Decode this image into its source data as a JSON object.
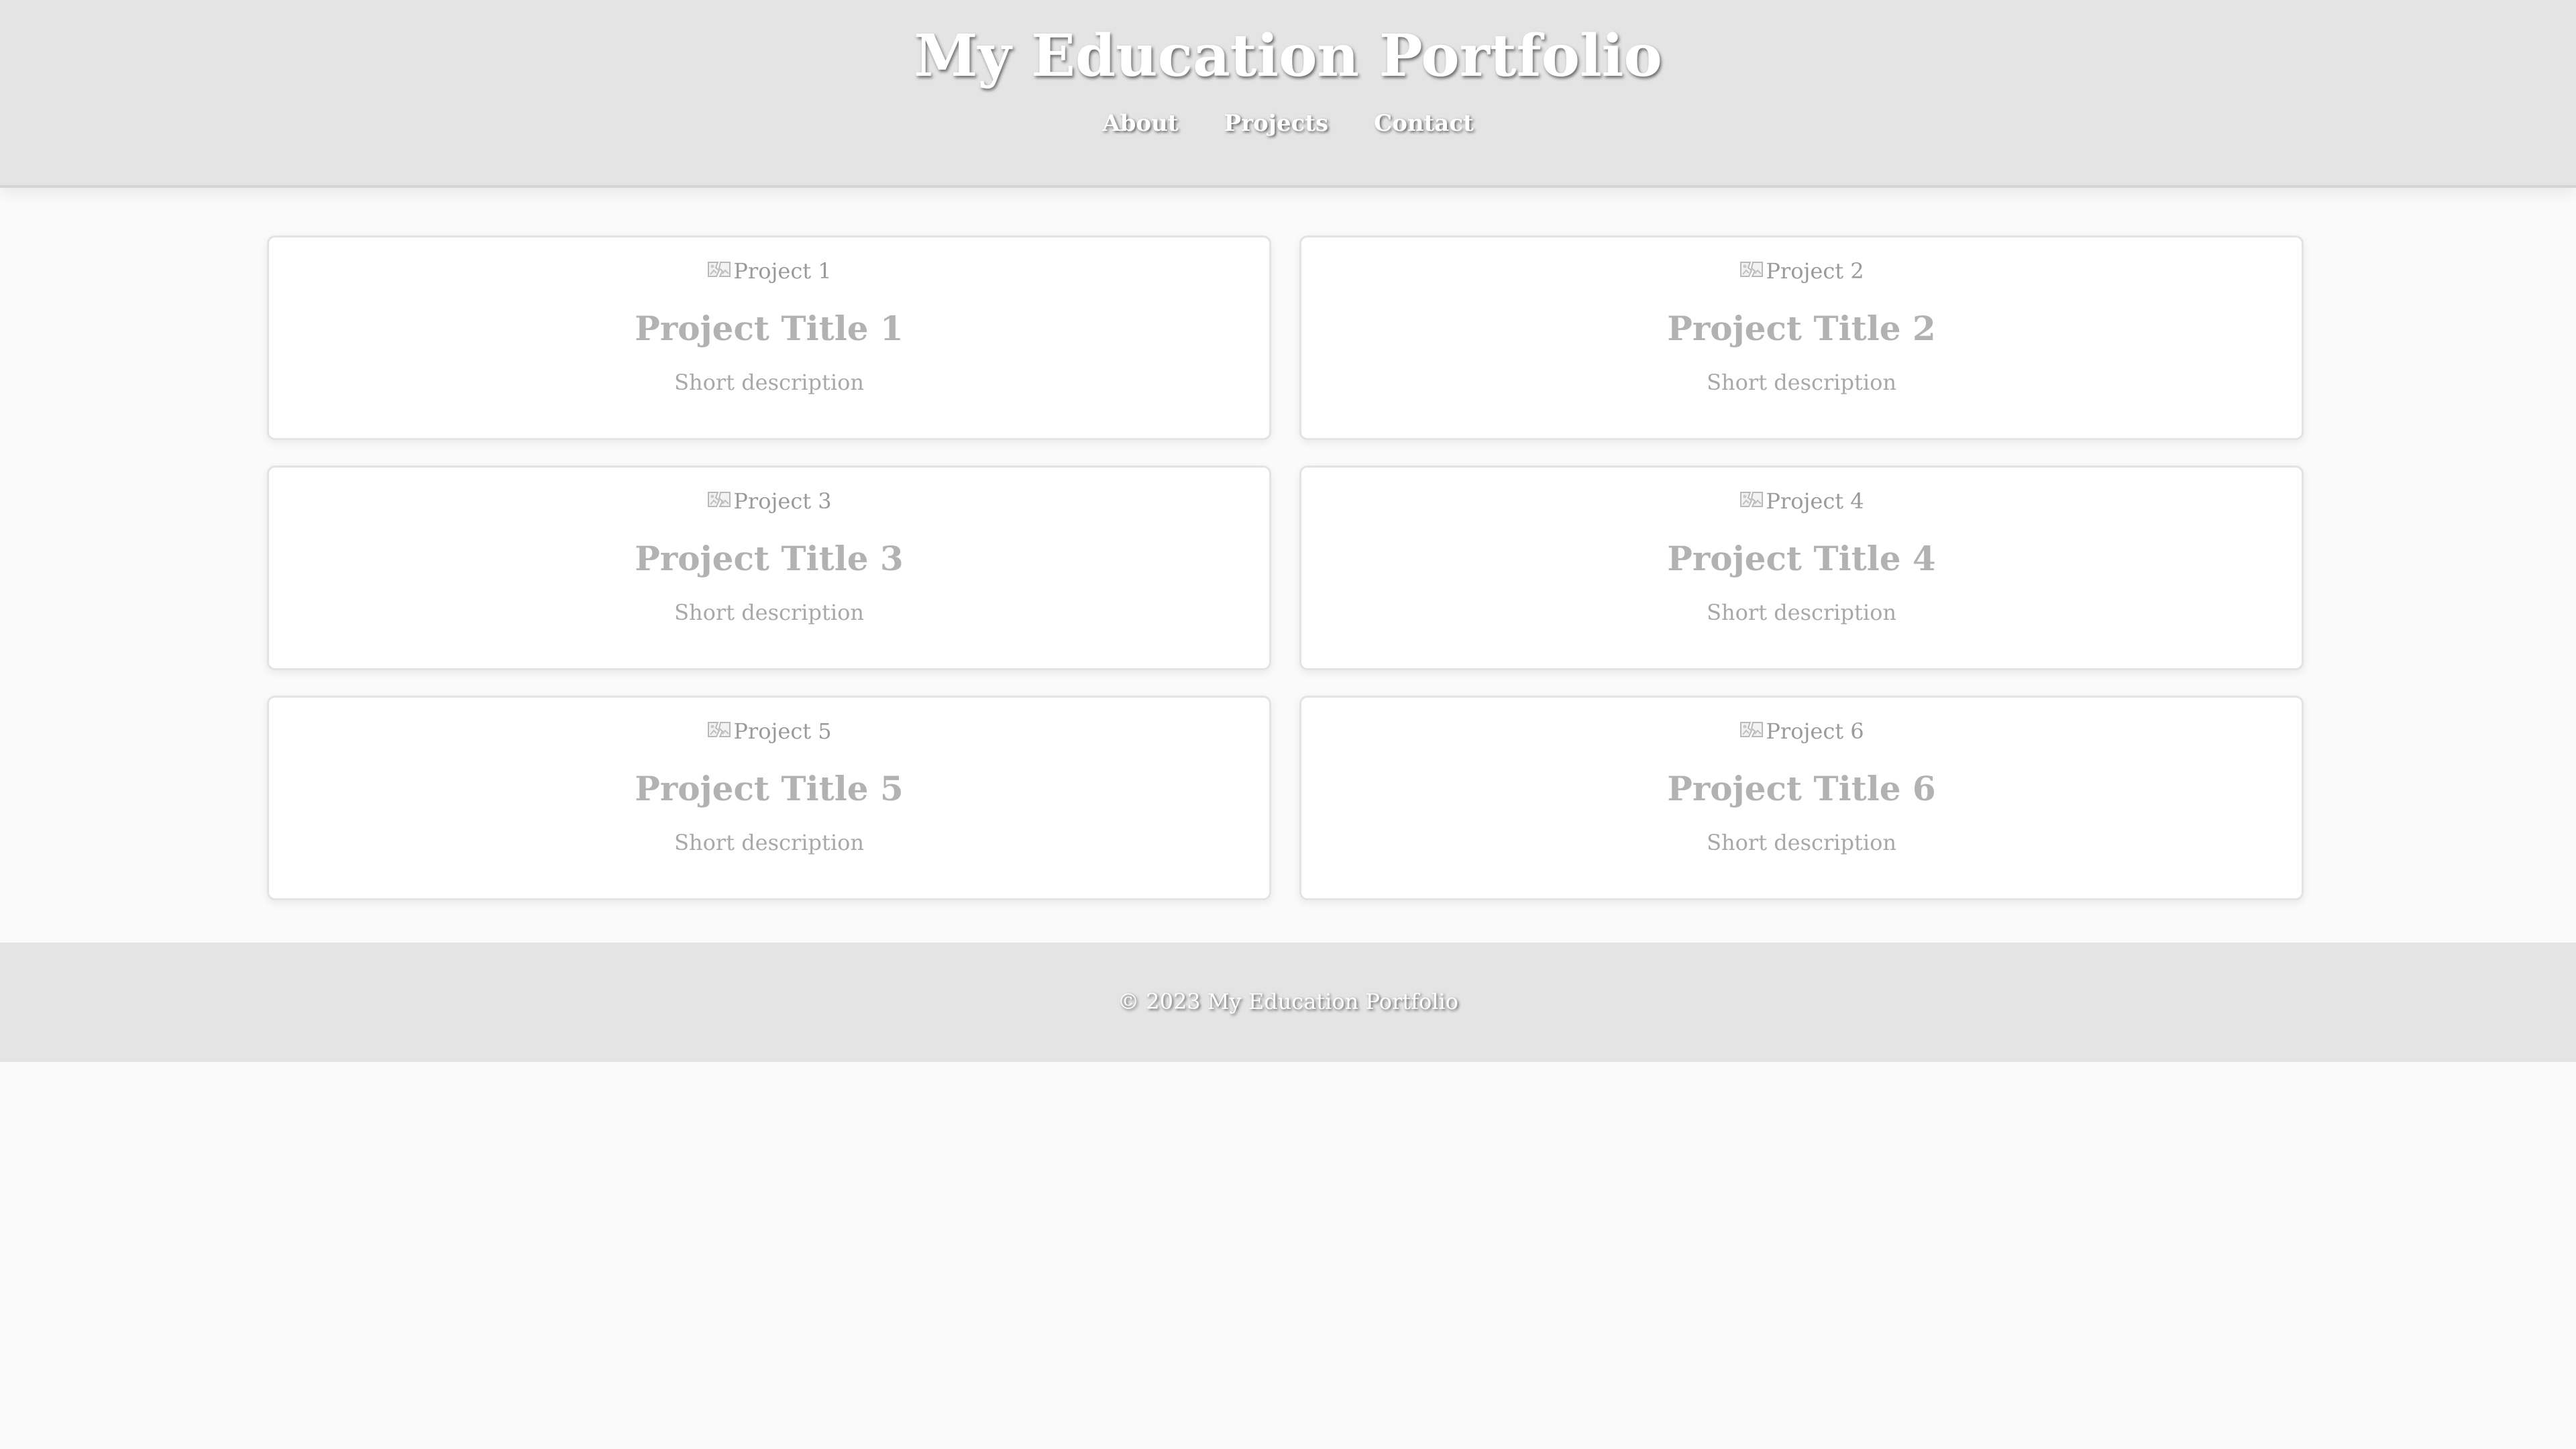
{
  "header": {
    "title": "My Education Portfolio",
    "nav": [
      {
        "label": "About",
        "name": "nav-about"
      },
      {
        "label": "Projects",
        "name": "nav-projects"
      },
      {
        "label": "Contact",
        "name": "nav-contact"
      }
    ]
  },
  "projects": [
    {
      "image_alt": "Project 1",
      "title": "Project Title 1",
      "description": "Short description"
    },
    {
      "image_alt": "Project 2",
      "title": "Project Title 2",
      "description": "Short description"
    },
    {
      "image_alt": "Project 3",
      "title": "Project Title 3",
      "description": "Short description"
    },
    {
      "image_alt": "Project 4",
      "title": "Project Title 4",
      "description": "Short description"
    },
    {
      "image_alt": "Project 5",
      "title": "Project Title 5",
      "description": "Short description"
    },
    {
      "image_alt": "Project 6",
      "title": "Project Title 6",
      "description": "Short description"
    }
  ],
  "footer": {
    "text": "© 2023 My Education Portfolio"
  },
  "icons": {
    "card_image": "broken-image-icon"
  },
  "colors": {
    "header_bg": "#e4e4e4",
    "page_bg": "#fafafa",
    "card_bg": "#ffffff",
    "footer_bg": "#e4e4e4"
  }
}
